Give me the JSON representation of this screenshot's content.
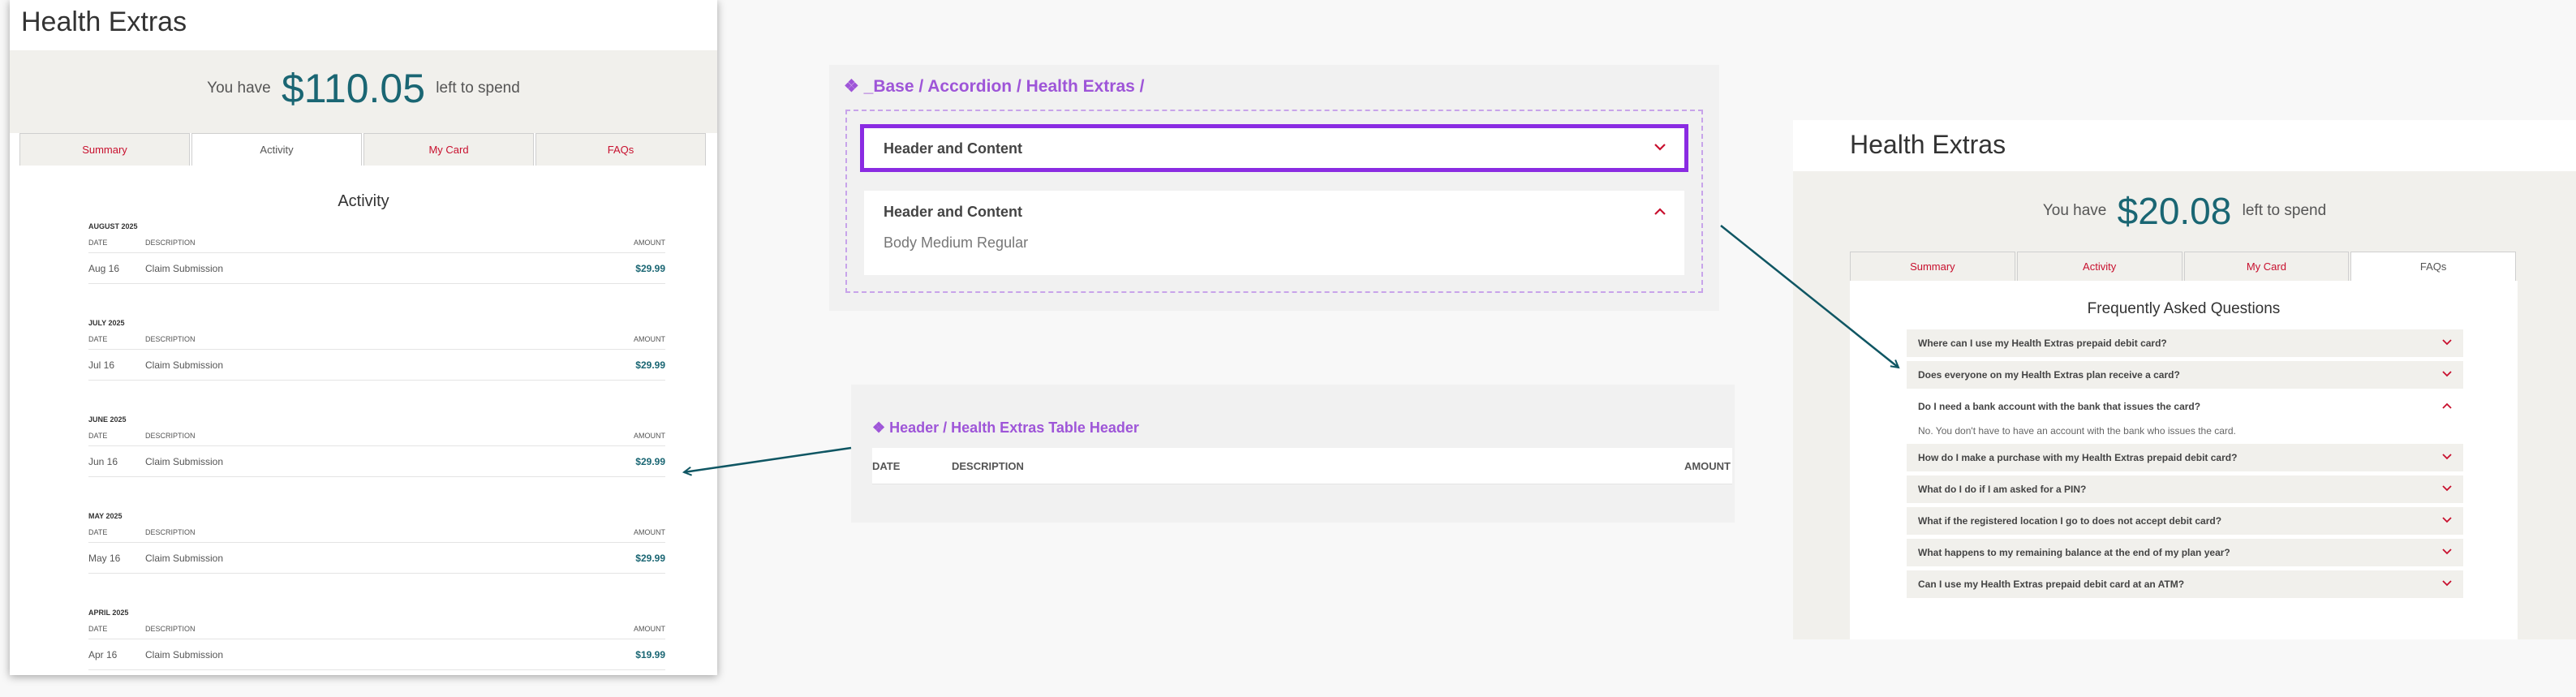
{
  "left_screen": {
    "app_title": "Health Extras",
    "balance": {
      "prefix": "You have",
      "amount": "$110.05",
      "suffix": "left to spend"
    },
    "tabs": [
      {
        "label": "Summary",
        "active": false
      },
      {
        "label": "Activity",
        "active": true
      },
      {
        "label": "My Card",
        "active": false
      },
      {
        "label": "FAQs",
        "active": false
      }
    ],
    "panel_title": "Activity",
    "columns": {
      "date": "DATE",
      "description": "DESCRIPTION",
      "amount": "AMOUNT"
    },
    "months": [
      {
        "month": "AUGUST 2025",
        "rows": [
          {
            "date": "Aug 16",
            "description": "Claim Submission",
            "amount": "$29.99"
          }
        ]
      },
      {
        "month": "JULY 2025",
        "rows": [
          {
            "date": "Jul 16",
            "description": "Claim Submission",
            "amount": "$29.99"
          }
        ]
      },
      {
        "month": "JUNE 2025",
        "rows": [
          {
            "date": "Jun 16",
            "description": "Claim Submission",
            "amount": "$29.99"
          }
        ]
      },
      {
        "month": "MAY 2025",
        "rows": [
          {
            "date": "May 16",
            "description": "Claim Submission",
            "amount": "$29.99"
          }
        ]
      },
      {
        "month": "APRIL 2025",
        "rows": [
          {
            "date": "Apr 16",
            "description": "Claim Submission",
            "amount": "$19.99"
          }
        ]
      }
    ]
  },
  "accordion_component": {
    "title": "❖ _Base / Accordion / Health Extras /",
    "collapsed": {
      "header": "Header and Content",
      "chevron": "chevron-down-icon"
    },
    "expanded": {
      "header": "Header and Content",
      "body": "Body Medium Regular",
      "chevron": "chevron-up-icon"
    }
  },
  "table_header_component": {
    "title": "❖ Header / Health Extras Table Header",
    "columns": {
      "date": "DATE",
      "description": "DESCRIPTION",
      "amount": "AMOUNT"
    }
  },
  "right_screen": {
    "app_title": "Health Extras",
    "balance": {
      "prefix": "You have",
      "amount": "$20.08",
      "suffix": "left to spend"
    },
    "tabs": [
      {
        "label": "Summary",
        "active": false
      },
      {
        "label": "Activity",
        "active": false
      },
      {
        "label": "My Card",
        "active": false
      },
      {
        "label": "FAQs",
        "active": true
      }
    ],
    "panel_title": "Frequently Asked Questions",
    "faqs": [
      {
        "question": "Where can I use my Health Extras prepaid debit card?",
        "open": false
      },
      {
        "question": "Does everyone on my Health Extras plan receive a card?",
        "open": false
      },
      {
        "question": "Do I need a bank account with the bank that issues the card?",
        "open": true,
        "answer": "No. You don't have to have an account with the bank who issues the card."
      },
      {
        "question": "How do I make a purchase with my Health Extras prepaid debit card?",
        "open": false
      },
      {
        "question": "What do I do if I am asked for a PIN?",
        "open": false
      },
      {
        "question": "What if the registered location I go to does not accept debit card?",
        "open": false
      },
      {
        "question": "What happens to my remaining balance at the end of my plan year?",
        "open": false
      },
      {
        "question": "Can I use my Health Extras prepaid debit card at an ATM?",
        "open": false
      }
    ]
  },
  "colors": {
    "accent_teal": "#1a6673",
    "brand_red": "#c8102e",
    "component_purple": "#9e55d8",
    "selection_purple": "#8a2be2",
    "arrow": "#0f5663"
  }
}
